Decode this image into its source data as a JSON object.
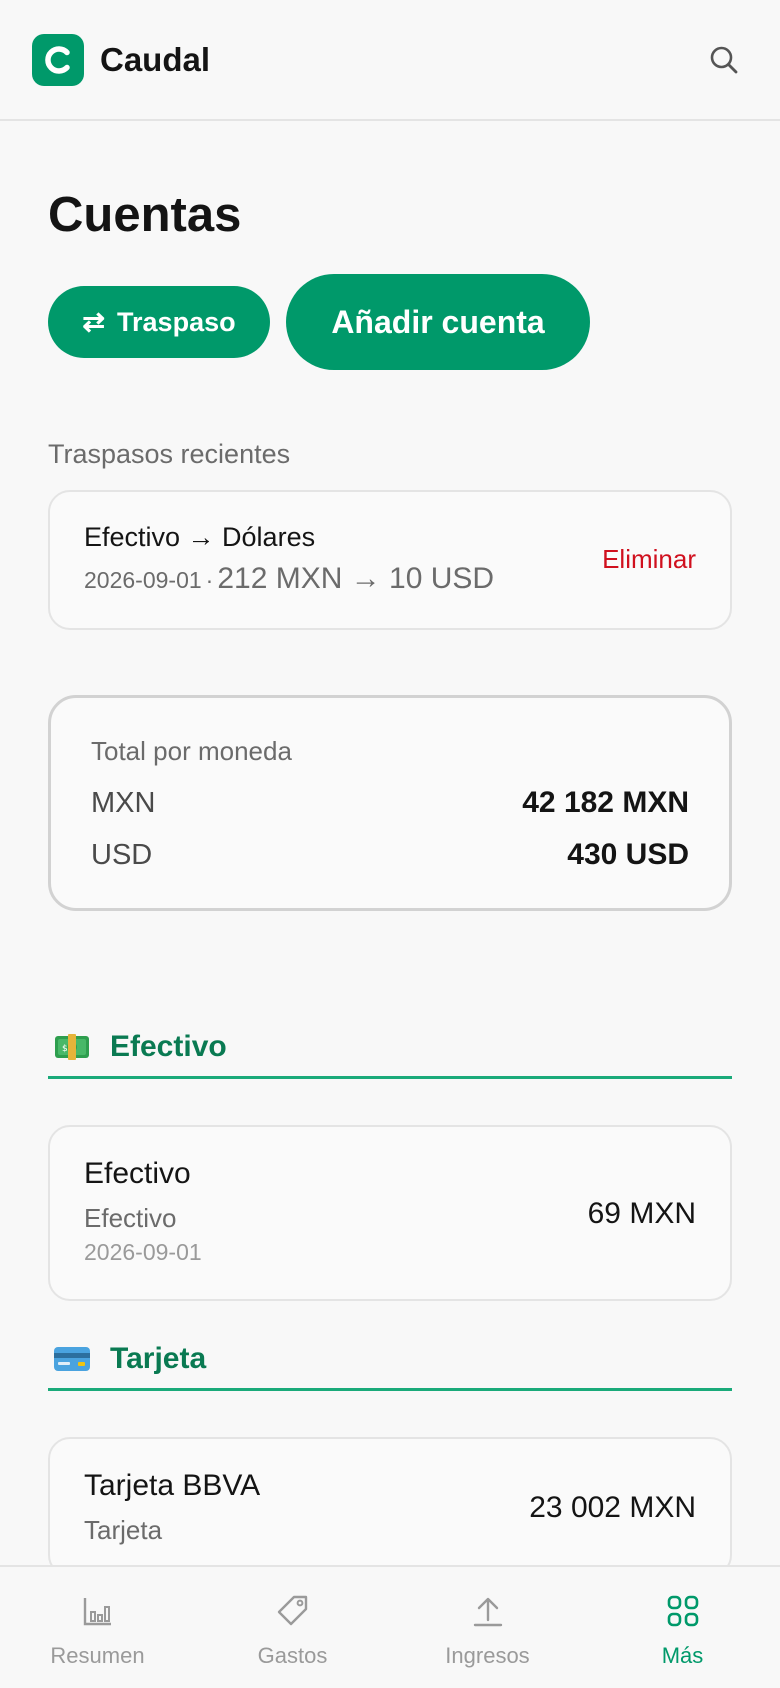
{
  "app": {
    "name": "Caudal",
    "logo_letter": "C"
  },
  "page": {
    "title": "Cuentas"
  },
  "actions": {
    "transfer_icon": "⇄",
    "transfer_label": "Traspaso",
    "add_label": "Añadir cuenta"
  },
  "recent_transfers": {
    "label": "Traspasos recientes",
    "items": [
      {
        "title": "Efectivo → Dólares",
        "date": "2026-09-01",
        "separator": "·",
        "amount": "212 MXN → 10 USD",
        "delete_label": "Eliminar"
      }
    ]
  },
  "totals": {
    "title": "Total por moneda",
    "rows": [
      {
        "currency": "MXN",
        "value": "42 182 MXN"
      },
      {
        "currency": "USD",
        "value": "430 USD"
      }
    ]
  },
  "groups": [
    {
      "title": "Efectivo",
      "icon": "money-icon",
      "accounts": [
        {
          "name": "Efectivo",
          "type": "Efectivo",
          "date": "2026-09-01",
          "amount": "69 MXN"
        }
      ]
    },
    {
      "title": "Tarjeta",
      "icon": "credit-card-icon",
      "accounts": [
        {
          "name": "Tarjeta BBVA",
          "type": "Tarjeta",
          "amount": "23 002 MXN"
        }
      ]
    }
  ],
  "nav": {
    "items": [
      {
        "label": "Resumen",
        "icon": "chart-icon"
      },
      {
        "label": "Gastos",
        "icon": "tag-icon"
      },
      {
        "label": "Ingresos",
        "icon": "upload-icon"
      },
      {
        "label": "Más",
        "icon": "grid-icon",
        "active": true
      }
    ]
  },
  "colors": {
    "accent": "#00996a",
    "group_title": "#0a7a52",
    "divider": "#1aaa7a",
    "danger": "#d0101e"
  }
}
